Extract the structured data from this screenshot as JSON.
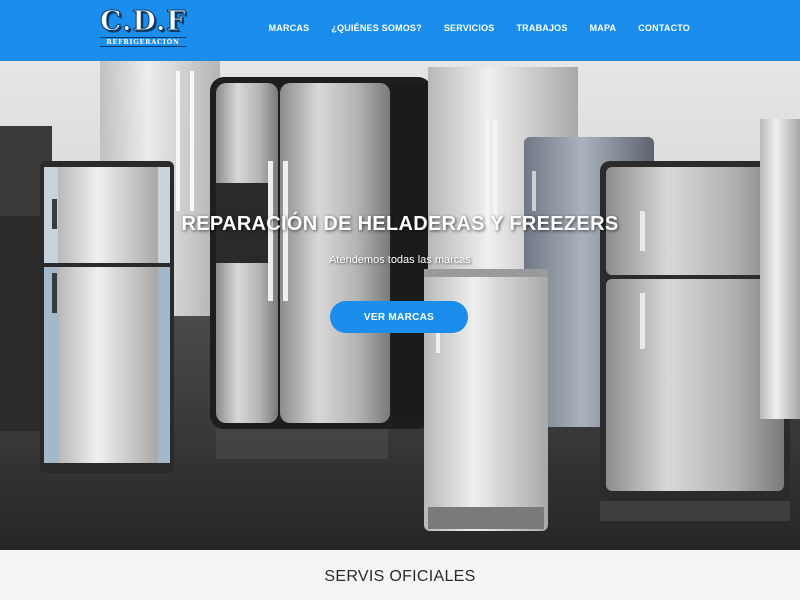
{
  "brand": {
    "name": "C.D.F",
    "tagline": "REFRIGERACIÓN"
  },
  "nav": {
    "items": [
      {
        "label": "MARCAS"
      },
      {
        "label": "¿QUIÉNES SOMOS?"
      },
      {
        "label": "SERVICIOS"
      },
      {
        "label": "TRABAJOS"
      },
      {
        "label": "MAPA"
      },
      {
        "label": "CONTACTO"
      }
    ]
  },
  "hero": {
    "title": "REPARACIÓN DE HELADERAS Y FREEZERS",
    "subtitle": "Atendemos todas las marcas",
    "button_label": "VER MARCAS",
    "image_subject": "row of refrigerators and freezers"
  },
  "section": {
    "title": "SERVIS OFICIALES"
  },
  "colors": {
    "accent": "#1a8ded",
    "header_bg": "#1a8ded",
    "text_dark": "#2b2b2b",
    "section_bg": "#f5f5f5"
  }
}
